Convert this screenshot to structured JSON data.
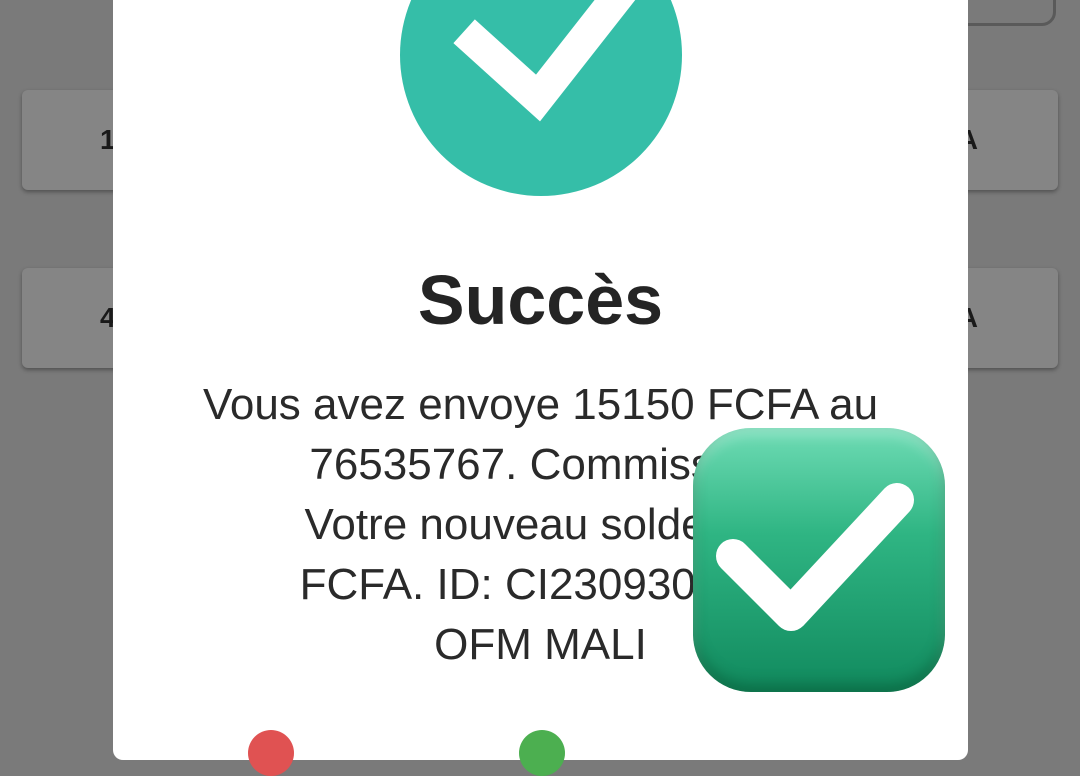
{
  "background": {
    "card1": {
      "left_text": "1",
      "right_text": "A"
    },
    "card2": {
      "left_text": "4",
      "right_text": "A"
    }
  },
  "dialog": {
    "title": "Succès",
    "message_lines": [
      "Vous avez envoye 15150 FCFA au",
      "76535767. Commission",
      "Votre nouveau solde est",
      "FCFA. ID: CI230930.100",
      "OFM MALI"
    ],
    "icon": "check-circle-icon"
  },
  "overlay": {
    "icon": "check-mark-button-icon"
  },
  "colors": {
    "success_teal": "#35bea8",
    "emoji_green": "#2fb583",
    "cancel_red": "#e05252",
    "confirm_green": "#4caf50"
  }
}
